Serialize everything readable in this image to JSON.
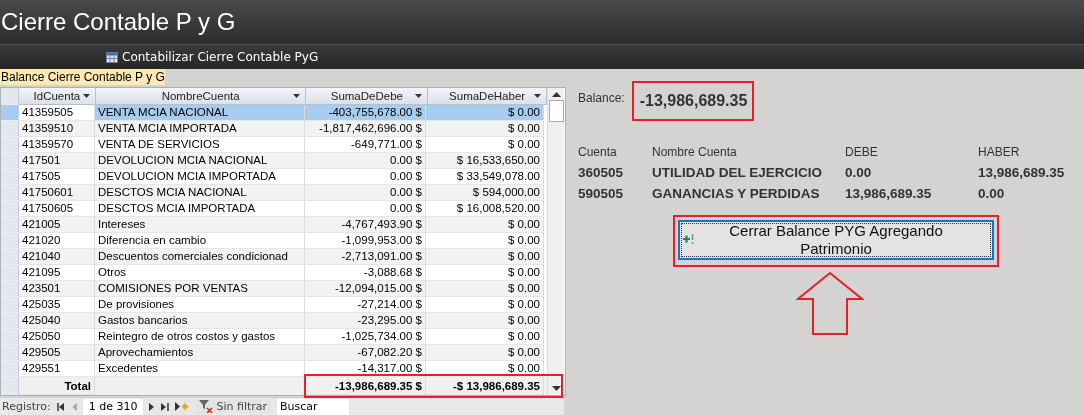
{
  "window": {
    "title": "Cierre Contable P y G"
  },
  "toolbar": {
    "button": "Contabilizar Cierre Contable PyG"
  },
  "subform": {
    "caption": "Balance Cierre Contable P y G",
    "columns": [
      "IdCuenta",
      "NombreCuenta",
      "SumaDeDebe",
      "SumaDeHaber"
    ],
    "rows": [
      {
        "id": "41359505",
        "name": "VENTA MCIA NACIONAL",
        "debe": "-403,755,678.00 $",
        "haber": "$ 0.00",
        "selected": true
      },
      {
        "id": "41359510",
        "name": "VENTA MCIA IMPORTADA",
        "debe": "-1,817,462,696.00 $",
        "haber": "$ 0.00",
        "selected": false
      },
      {
        "id": "41359570",
        "name": "VENTA DE SERVICIOS",
        "debe": "-649,771.00 $",
        "haber": "$ 0.00",
        "selected": false
      },
      {
        "id": "417501",
        "name": "DEVOLUCION MCIA NACIONAL",
        "debe": "0.00 $",
        "haber": "$ 16,533,650.00",
        "selected": false
      },
      {
        "id": "417505",
        "name": "DEVOLUCION MCIA IMPORTADA",
        "debe": "0.00 $",
        "haber": "$ 33,549,078.00",
        "selected": false
      },
      {
        "id": "41750601",
        "name": "DESCTOS MCIA NACIONAL",
        "debe": "0.00 $",
        "haber": "$ 594,000.00",
        "selected": false
      },
      {
        "id": "41750605",
        "name": "DESCTOS MCIA IMPORTADA",
        "debe": "0.00 $",
        "haber": "$ 16,008,520.00",
        "selected": false
      },
      {
        "id": "421005",
        "name": "Intereses",
        "debe": "-4,767,493.90 $",
        "haber": "$ 0.00",
        "selected": false
      },
      {
        "id": "421020",
        "name": "Diferencia en cambio",
        "debe": "-1,099,953.00 $",
        "haber": "$ 0.00",
        "selected": false
      },
      {
        "id": "421040",
        "name": "Descuentos comerciales condicionad",
        "debe": "-2,713,091.00 $",
        "haber": "$ 0.00",
        "selected": false
      },
      {
        "id": "421095",
        "name": "Otros",
        "debe": "-3,088.68 $",
        "haber": "$ 0.00",
        "selected": false
      },
      {
        "id": "423501",
        "name": "COMISIONES POR VENTAS",
        "debe": "-12,094,015.00 $",
        "haber": "$ 0.00",
        "selected": false
      },
      {
        "id": "425035",
        "name": "De  provisiones",
        "debe": "-27,214.00 $",
        "haber": "$ 0.00",
        "selected": false
      },
      {
        "id": "425040",
        "name": "Gastos bancarios",
        "debe": "-23,295.00 $",
        "haber": "$ 0.00",
        "selected": false
      },
      {
        "id": "425050",
        "name": "Reintegro de otros costos y gastos",
        "debe": "-1,025,734.00 $",
        "haber": "$ 0.00",
        "selected": false
      },
      {
        "id": "429505",
        "name": "Aprovechamientos",
        "debe": "-67,082.20 $",
        "haber": "$ 0.00",
        "selected": false
      },
      {
        "id": "429551",
        "name": "Excedentes",
        "debe": "-14,317.00 $",
        "haber": "$ 0.00",
        "selected": false
      }
    ],
    "total": {
      "label": "Total",
      "debe": "-13,986,689.35 $",
      "haber": "-$ 13,986,689.35"
    },
    "navigation": {
      "label": "Registro:",
      "position": "1 de 310",
      "filter": "Sin filtrar",
      "search_placeholder": "Buscar"
    }
  },
  "balance": {
    "label": "Balance:",
    "value": "-13,986,689.35"
  },
  "summary": {
    "columns": [
      "Cuenta",
      "Nombre Cuenta",
      "DEBE",
      "HABER"
    ],
    "rows": [
      {
        "cuenta": "360505",
        "nombre": "UTILIDAD DEL EJERCICIO",
        "debe": "0.00",
        "haber": "13,986,689.35"
      },
      {
        "cuenta": "590505",
        "nombre": "GANANCIAS Y PERDIDAS",
        "debe": "13,986,689.35",
        "haber": "0.00"
      }
    ]
  },
  "close_button": "Cerrar Balance PYG Agregando Patrimonio"
}
